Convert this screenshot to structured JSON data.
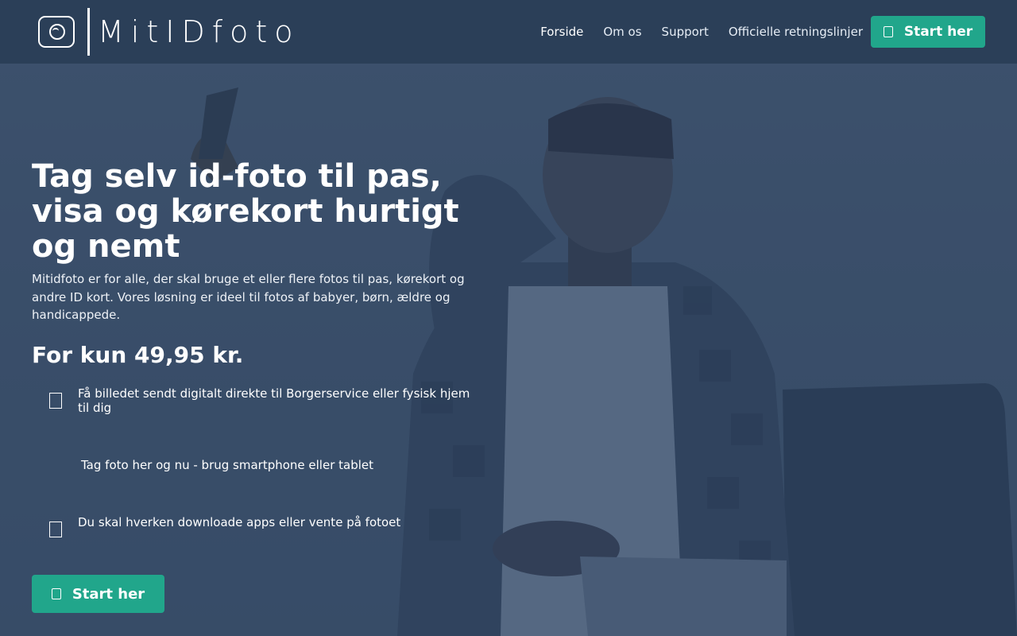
{
  "brand": {
    "name": "MitIDfoto"
  },
  "nav": {
    "items": [
      {
        "label": "Forside"
      },
      {
        "label": "Om os"
      },
      {
        "label": "Support"
      },
      {
        "label": "Officielle retningslinjer"
      }
    ],
    "cta_label": "Start her"
  },
  "hero": {
    "headline": "Tag selv id-foto til pas, visa og kørekort hurtigt og nemt",
    "lead": "Mitidfoto er for alle, der skal bruge et eller flere fotos til pas, kørekort og andre ID kort. Vores løsning er ideel til fotos af babyer, børn, ældre og handicappede.",
    "price": "For kun 49,95 kr.",
    "features": [
      {
        "icon": "document-icon",
        "text": "Få billedet sendt digitalt direkte til Borgerservice eller fysisk hjem til dig"
      },
      {
        "icon": "none",
        "text": "Tag foto her og nu - brug smartphone eller tablet"
      },
      {
        "icon": "document-icon",
        "text": "Du skal hverken downloade apps eller vente på fotoet"
      }
    ],
    "cta_label": "Start her"
  },
  "colors": {
    "header_bg": "#2b3f58",
    "accent": "#21a68b",
    "overlay": "#283e5c"
  }
}
